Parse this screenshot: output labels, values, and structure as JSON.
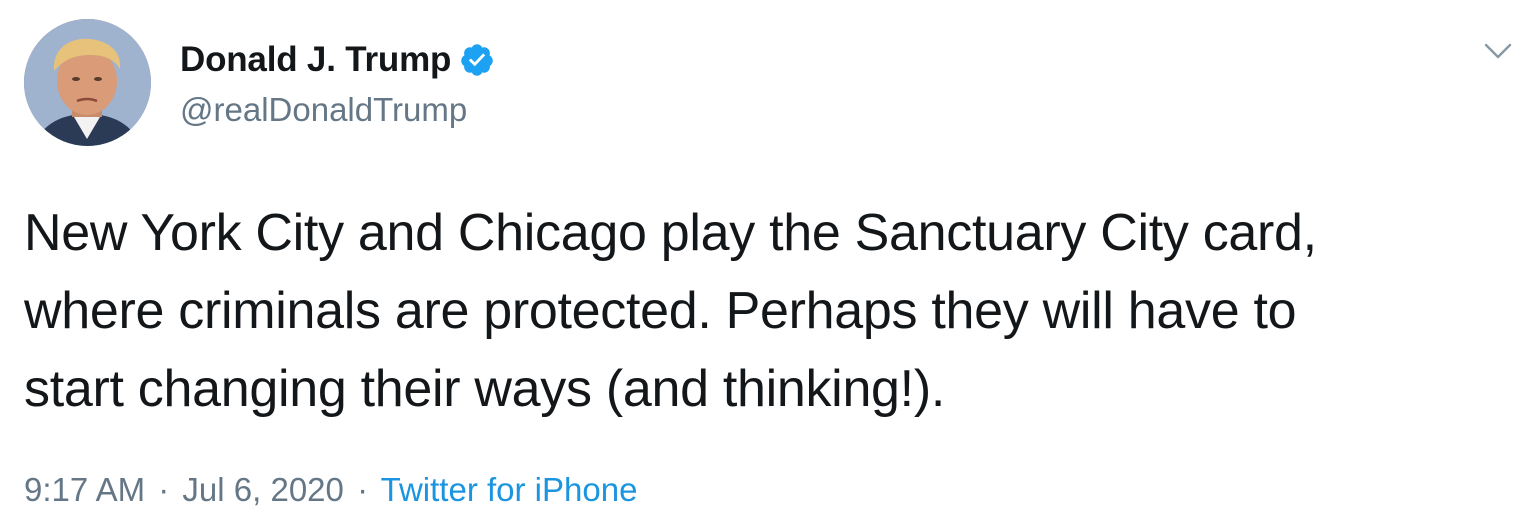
{
  "tweet": {
    "author": {
      "display_name": "Donald J. Trump",
      "handle": "@realDonaldTrump",
      "verified": true,
      "avatar_icon": "profile-photo"
    },
    "text": "New York City and Chicago play the Sanctuary City card,\nwhere criminals are protected. Perhaps they will have to\nstart changing their ways (and thinking!).",
    "time": "9:17 AM",
    "date": "Jul 6, 2020",
    "separator": "·",
    "source": "Twitter for iPhone",
    "menu_icon": "chevron-down-icon"
  },
  "colors": {
    "text_primary": "#14171a",
    "text_secondary": "#657786",
    "link": "#1b95e0",
    "verified_badge": "#1da1f2",
    "background": "#ffffff"
  }
}
